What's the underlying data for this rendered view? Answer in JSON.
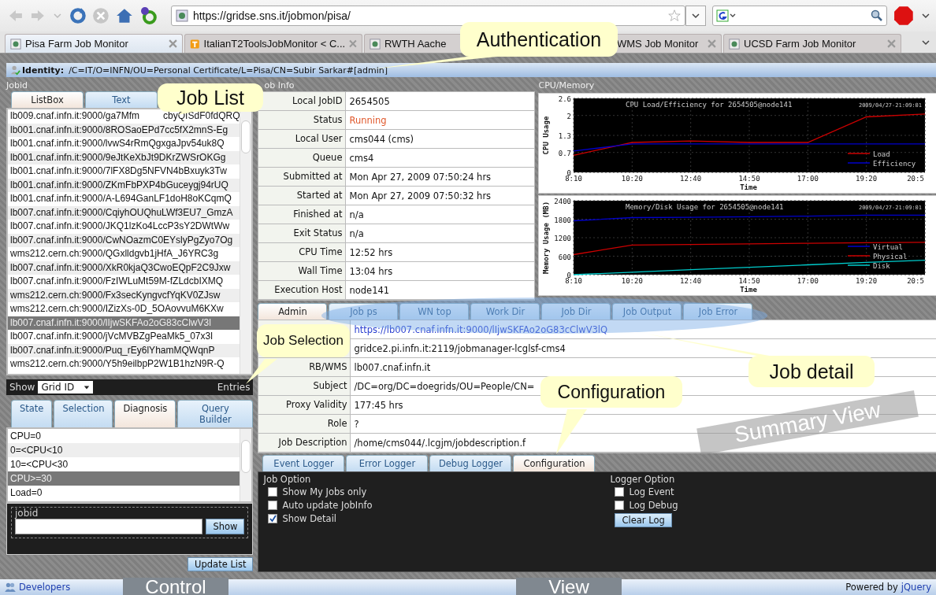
{
  "browser": {
    "url": "https://gridse.sns.it/jobmon/pisa/",
    "tabs": [
      {
        "label": "Pisa Farm Job Monitor",
        "selected": true,
        "kind": "page"
      },
      {
        "label": "ItalianT2ToolsJobMonitor < C...",
        "selected": false,
        "kind": "t"
      },
      {
        "label": "RWTH Aache",
        "selected": false,
        "kind": "page_cut"
      },
      {
        "label": "WMS Job Monitor",
        "selected": false,
        "kind": "none"
      },
      {
        "label": "UCSD Farm Job Monitor",
        "selected": false,
        "kind": "page"
      }
    ]
  },
  "identity": {
    "label": "Identity:",
    "value": "/C=IT/O=INFN/OU=Personal Certificate/L=Pisa/CN=Subir Sarkar#[admin]"
  },
  "jobid_panel": {
    "title": "Jobid",
    "tabs": [
      {
        "label": "ListBox",
        "selected": true
      },
      {
        "label": "Text",
        "selected": false
      }
    ],
    "rows": [
      {
        "text": "lb009.cnaf.infn.it:9000/ga7Mfm",
        "after": "cbyQISdF0fdQRQ",
        "selected": false
      },
      {
        "text": "lb001.cnaf.infn.it:9000/8ROSaoEPd7cc5fX2mnS-Eg",
        "selected": false
      },
      {
        "text": "lb001.cnaf.infn.it:9000/lvwS4rRmQgxgaJpv54uk8Q",
        "selected": false
      },
      {
        "text": "lb001.cnaf.infn.it:9000/9eJtKeXbJt9DKrZWSrOKGg",
        "selected": false
      },
      {
        "text": "lb001.cnaf.infn.it:9000/7lFX8Dg5NFVN4bBxuyk3Tw",
        "selected": false
      },
      {
        "text": "lb001.cnaf.infn.it:9000/ZKmFbPXP4bGuceygj94rUQ",
        "selected": false
      },
      {
        "text": "lb001.cnaf.infn.it:9000/A-L694GanLF1doH8oKCqmQ",
        "selected": false
      },
      {
        "text": "lb007.cnaf.infn.it:9000/CqiyhOUQhuLWf3EU7_GmzA",
        "selected": false
      },
      {
        "text": "lb007.cnaf.infn.it:9000/JKQ1lzKo4LccP3sY2DWtWw",
        "selected": false
      },
      {
        "text": "lb007.cnaf.infn.it:9000/CwNOazmC0EYslyPgZyo7Og",
        "selected": false
      },
      {
        "text": "wms212.cern.ch:9000/QGxlldgvb1jHfA_J6YRC3g",
        "selected": false
      },
      {
        "text": "lb007.cnaf.infn.it:9000/XkR0kjaQ3CwoEQpF2C9Jxw",
        "selected": false
      },
      {
        "text": "lb007.cnaf.infn.it:9000/FzIWLuMt59M-fZLdcbIXMQ",
        "selected": false
      },
      {
        "text": "wms212.cern.ch:9000/Fx3secKyngvcfYqKV0ZJsw",
        "selected": false
      },
      {
        "text": "wms212.cern.ch:9000/IZizXs-0D_5OAovvuM6KXw",
        "selected": false
      },
      {
        "text": "lb007.cnaf.infn.it:9000/lIjwSKFAo2oG83cClwV3l",
        "selected": true
      },
      {
        "text": "lb007.cnaf.infn.it:9000/jVcMVBZgPeaMk5_07x3l",
        "selected": false
      },
      {
        "text": "lb007.cnaf.infn.it:9000/Puq_rEy6lYhamMQWqnP",
        "selected": false
      },
      {
        "text": "wms212.cern.ch:9000/Y5h9eilbpP2W1B1hzN9R-Q",
        "selected": false
      }
    ],
    "show_label": "Show",
    "show_select": "Grid ID",
    "entries_label": "Entries"
  },
  "filter_panel": {
    "tabs": [
      {
        "label": "State",
        "selected": false
      },
      {
        "label": "Selection",
        "selected": false
      },
      {
        "label": "Diagnosis",
        "selected": true
      },
      {
        "label": "Query Builder",
        "selected": false
      }
    ],
    "rows": [
      {
        "text": "CPU=0",
        "selected": false
      },
      {
        "text": "0=<CPU<10",
        "selected": false
      },
      {
        "text": "10=<CPU<30",
        "selected": false
      },
      {
        "text": "CPU>=30",
        "selected": true
      },
      {
        "text": "Load=0",
        "selected": false
      }
    ],
    "jobid_legend": "jobid",
    "show_button": "Show",
    "update_button": "Update List"
  },
  "job_info": {
    "title": "ob Info",
    "rows": [
      {
        "label": "Local JobID",
        "value": "2654505",
        "kind": "plain"
      },
      {
        "label": "Status",
        "value": "Running",
        "kind": "status"
      },
      {
        "label": "Local User",
        "value": "cms044 (cms)",
        "kind": "plain"
      },
      {
        "label": "Queue",
        "value": "cms4",
        "kind": "plain"
      },
      {
        "label": "Submitted at",
        "value": "Mon Apr 27, 2009 07:50:24 hrs",
        "kind": "plain"
      },
      {
        "label": "Started at",
        "value": "Mon Apr 27, 2009 07:50:32 hrs",
        "kind": "plain"
      },
      {
        "label": "Finished at",
        "value": "n/a",
        "kind": "plain"
      },
      {
        "label": "Exit Status",
        "value": "n/a",
        "kind": "plain"
      },
      {
        "label": "CPU Time",
        "value": "12:52 hrs",
        "kind": "plain"
      },
      {
        "label": "Wall Time",
        "value": "13:04 hrs",
        "kind": "plain"
      },
      {
        "label": "Execution Host",
        "value": "node141",
        "kind": "plain"
      }
    ]
  },
  "cpu_memory": {
    "title": "CPU/Memory",
    "charts": [
      {
        "timestamp": "2009/04/27-21:09:01",
        "chart_data": {
          "type": "line",
          "grid": true,
          "legend": true,
          "title": "CPU Load/Efficiency for 2654505@node141",
          "xlabel": "Time",
          "ylabel": "CPU Usage",
          "categories": [
            "8:10",
            "10:20",
            "12:40",
            "14:50",
            "17:00",
            "19:20",
            "20:5"
          ],
          "ylim": [
            0,
            2.6
          ],
          "yticks": [
            0,
            0.7,
            1.3,
            2.0,
            2.6
          ],
          "series": [
            {
              "name": "Load",
              "color": "#cc0000",
              "values": [
                0.6,
                1.05,
                1.1,
                1.05,
                1.05,
                1.95,
                2.05
              ]
            },
            {
              "name": "Efficiency",
              "color": "#0000cc",
              "values": [
                0.75,
                1.0,
                1.0,
                1.0,
                1.0,
                1.0,
                1.0
              ]
            }
          ]
        }
      },
      {
        "timestamp": "2009/04/27-21:09:01",
        "chart_data": {
          "type": "line",
          "grid": true,
          "legend": true,
          "title": "Memory/Disk Usage for 2654505@node141",
          "xlabel": "Time",
          "ylabel": "Memory Usage (MB)",
          "categories": [
            "8:10",
            "10:20",
            "12:40",
            "14:50",
            "17:00",
            "19:20",
            "20:5"
          ],
          "ylim": [
            0,
            2400
          ],
          "yticks": [
            0,
            600,
            1200,
            1800,
            2400
          ],
          "series": [
            {
              "name": "Virtual",
              "color": "#0000cc",
              "values": [
                1750,
                1850,
                1860,
                1880,
                1900,
                1930,
                1930
              ]
            },
            {
              "name": "Physical",
              "color": "#cc0000",
              "values": [
                650,
                960,
                980,
                1000,
                1020,
                1040,
                1050
              ]
            },
            {
              "name": "Disk",
              "color": "#00cccc",
              "values": [
                0,
                80,
                160,
                240,
                320,
                400,
                470
              ]
            }
          ]
        }
      }
    ]
  },
  "detail": {
    "tabs": [
      {
        "label": "Admin",
        "selected": true
      },
      {
        "label": "Job ps",
        "selected": false
      },
      {
        "label": "WN top",
        "selected": false
      },
      {
        "label": "Work Dir",
        "selected": false
      },
      {
        "label": "Job Dir",
        "selected": false
      },
      {
        "label": "Job Output",
        "selected": false
      },
      {
        "label": "Job Error",
        "selected": false
      }
    ],
    "rows": [
      {
        "value": "https://lb007.cnaf.infn.it:9000/lIjwSKFAo2oG83cClwV3lQ",
        "kind": "link"
      },
      {
        "value": "gridce2.pi.infn.it:2119/jobmanager-lcglsf-cms4",
        "kind": "plain"
      },
      {
        "label": "RB/WMS",
        "value": "lb007.cnaf.infn.it",
        "kind": "plain"
      },
      {
        "label": "Subject",
        "value": "/DC=org/DC=doegrids/OU=People/CN=",
        "kind": "plain"
      },
      {
        "label": "Proxy Validity",
        "value": "177:45 hrs",
        "kind": "plain"
      },
      {
        "label": "Role",
        "value": "?",
        "kind": "plain"
      },
      {
        "label": "Job Description",
        "value": "/home/cms044/.lcgjm/jobdescription.f",
        "kind": "plain"
      }
    ]
  },
  "logger": {
    "tabs": [
      {
        "label": "Event Logger",
        "selected": false
      },
      {
        "label": "Error Logger",
        "selected": false
      },
      {
        "label": "Debug Logger",
        "selected": false
      },
      {
        "label": "Configuration",
        "selected": true
      }
    ],
    "job_option": {
      "title": "Job Option",
      "options": [
        {
          "label": "Show My Jobs only",
          "checked": false
        },
        {
          "label": "Auto update JobInfo",
          "checked": false
        },
        {
          "label": "Show Detail",
          "checked": true
        }
      ]
    },
    "logger_option": {
      "title": "Logger Option",
      "options": [
        {
          "label": "Log Event",
          "checked": false
        },
        {
          "label": "Log Debug",
          "checked": false
        }
      ],
      "button": "Clear Log"
    }
  },
  "footer": {
    "developers": "Developers",
    "powered": "Powered by",
    "jquery": "jQuery"
  },
  "callouts": [
    {
      "text": "Authentication",
      "kind": "bubble"
    },
    {
      "text": "Job List",
      "kind": "bubble"
    },
    {
      "text": "Job Selection",
      "kind": "bubble"
    },
    {
      "text": "Job detail",
      "kind": "bubble"
    },
    {
      "text": "Configuration",
      "kind": "bubble"
    },
    {
      "text": "Control",
      "kind": "tag"
    },
    {
      "text": "View",
      "kind": "tag"
    }
  ],
  "overlay_label": "Summary View"
}
